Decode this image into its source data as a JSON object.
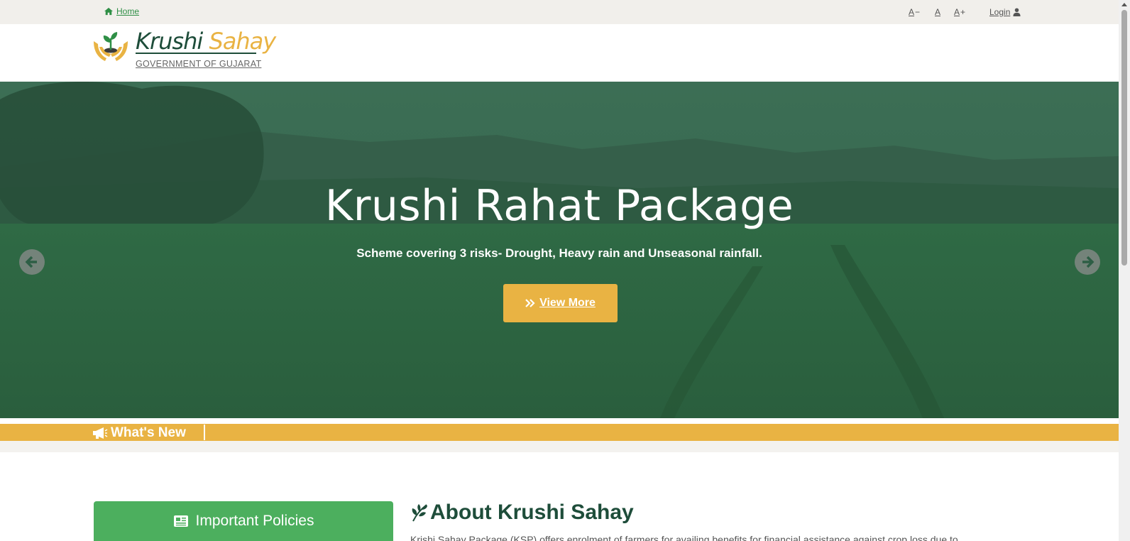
{
  "topbar": {
    "home_label": "Home",
    "font_decrease": {
      "letter": "A",
      "symbol": "−"
    },
    "font_normal": "A",
    "font_increase": {
      "letter": "A",
      "symbol": "+"
    },
    "login_label": "Login"
  },
  "header": {
    "logo_word1": "Krushi",
    "logo_word2": "Sahay",
    "logo_subtitle": "GOVERNMENT OF GUJARAT"
  },
  "hero": {
    "title": "Krushi Rahat Package",
    "subtitle": "Scheme covering 3 risks- Drought, Heavy rain and Unseasonal rainfall.",
    "button_label": "View More",
    "button_icon": "double-chevron-right-icon",
    "prev_icon": "arrow-left-circle-icon",
    "next_icon": "arrow-right-circle-icon"
  },
  "news": {
    "label": "What's New",
    "icon": "megaphone-icon"
  },
  "policies": {
    "label": "Important Policies",
    "icon": "newspaper-icon"
  },
  "about": {
    "title": "About Krushi Sahay",
    "icon": "leaf-icon",
    "text": "Krishi Sahay Package (KSP) offers enrolment of farmers for availing benefits for financial assistance against crop loss due to"
  },
  "colors": {
    "accent_green": "#4caf5e",
    "dark_green": "#1e4d3a",
    "gold": "#e9b343",
    "topbar_bg": "#f1efeb"
  }
}
